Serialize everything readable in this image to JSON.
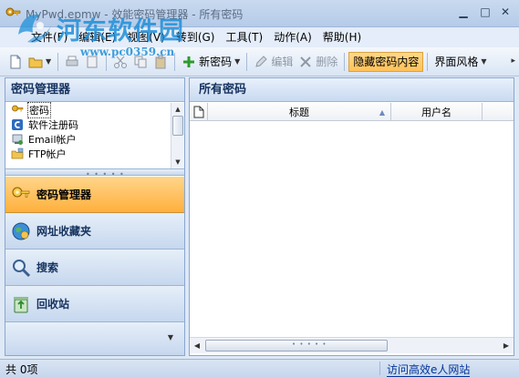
{
  "window": {
    "title": "MyPwd.epmw - 效能密码管理器 - 所有密码",
    "minimize": "▁",
    "maximize": "□",
    "close": "✕"
  },
  "watermark": {
    "text": "河东软件园",
    "url": "www.pc0359.cn"
  },
  "menu": {
    "items": [
      {
        "label": "文件(F)"
      },
      {
        "label": "编辑(E)"
      },
      {
        "label": "视图(V)"
      },
      {
        "label": "转到(G)"
      },
      {
        "label": "工具(T)"
      },
      {
        "label": "动作(A)"
      },
      {
        "label": "帮助(H)"
      }
    ]
  },
  "toolbar": {
    "new_password": "新密码",
    "edit": "编辑",
    "delete": "删除",
    "hide_passwords": "隐藏密码内容",
    "theme": "界面风格",
    "dropdown_arrow": "▼",
    "more": "▸"
  },
  "left_panel": {
    "title": "密码管理器",
    "categories": [
      {
        "label": "密码",
        "icon": "key-icon",
        "selected": true
      },
      {
        "label": "软件注册码",
        "icon": "software-c-icon",
        "selected": false
      },
      {
        "label": "Email帐户",
        "icon": "email-icon",
        "selected": false
      },
      {
        "label": "FTP帐户",
        "icon": "ftp-icon",
        "selected": false
      }
    ],
    "nav": [
      {
        "label": "密码管理器",
        "icon": "keys-icon",
        "active": true
      },
      {
        "label": "网址收藏夹",
        "icon": "globe-icon",
        "active": false
      },
      {
        "label": "搜索",
        "icon": "magnifier-icon",
        "active": false
      },
      {
        "label": "回收站",
        "icon": "recycle-icon",
        "active": false
      }
    ],
    "splitter_grip": "• • • • •",
    "scroll_up": "▲",
    "scroll_down": "▼",
    "footer_chevron": "▼"
  },
  "right_panel": {
    "title": "所有密码",
    "columns": {
      "title": "标题",
      "username": "用户名"
    },
    "sort_arrow": "▲",
    "scroll_left": "◀",
    "scroll_right": "▶",
    "scroll_grip": "• • • • •"
  },
  "status": {
    "count": "共 0项",
    "link": "访问高效e人网站"
  },
  "colors": {
    "accent_orange": "#ffb03c",
    "header_blue": "#c9daf1",
    "link_blue": "#003399"
  }
}
